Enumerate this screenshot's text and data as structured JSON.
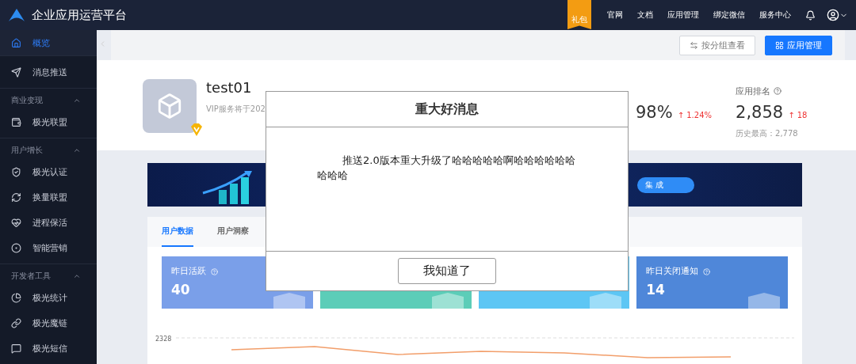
{
  "header": {
    "title": "企业应用运营平台",
    "gift_label": "礼包",
    "nav": [
      "官网",
      "文档",
      "应用管理",
      "绑定微信",
      "服务中心"
    ]
  },
  "sidebar": {
    "items": [
      {
        "label": "概览",
        "selected": true
      }
    ],
    "groups": [
      {
        "items": [
          {
            "label": "消息推送",
            "selected": false
          }
        ]
      },
      {
        "title": "商业变现",
        "items": [
          {
            "label": "极光联盟",
            "selected": false
          }
        ]
      },
      {
        "title": "用户增长",
        "items": [
          {
            "label": "极光认证",
            "selected": false
          },
          {
            "label": "换量联盟",
            "selected": false
          },
          {
            "label": "进程保活",
            "selected": false
          },
          {
            "label": "智能营销",
            "selected": false
          }
        ]
      },
      {
        "title": "开发者工具",
        "items": [
          {
            "label": "极光统计",
            "selected": false
          },
          {
            "label": "极光魔链",
            "selected": false
          },
          {
            "label": "极光短信",
            "selected": false
          }
        ]
      }
    ]
  },
  "toolbar": {
    "buttons": [
      {
        "label": "按分组查看",
        "kind": "outline"
      },
      {
        "label": "应用管理",
        "kind": "primary"
      }
    ]
  },
  "app": {
    "name": "test01",
    "vip_note": "VIP服务将于202"
  },
  "stats": [
    {
      "value": "98%",
      "delta": "↑ 1.24%"
    },
    {
      "label": "应用排名",
      "value": "2,858",
      "delta": "↑ 18",
      "note": "历史最高：2,778"
    }
  ],
  "banner": {
    "button": "集 成"
  },
  "tabs": [
    {
      "label": "用户数据",
      "selected": true
    },
    {
      "label": "用户洞察",
      "selected": false
    }
  ],
  "cards": [
    {
      "label": "昨日活跃",
      "value": "40",
      "color": "#7a9fe9"
    },
    {
      "color": "#5ccdb8"
    },
    {
      "color": "#5dc6f4"
    },
    {
      "label": "昨日关闭通知",
      "value": "14",
      "color": "#4f87d9"
    }
  ],
  "chart": {
    "tick": "2328"
  },
  "dialog": {
    "title": "重大好消息",
    "body": "推送2.0版本重大升级了哈哈哈哈哈啊哈哈哈哈哈哈哈哈哈",
    "button": "我知道了"
  }
}
